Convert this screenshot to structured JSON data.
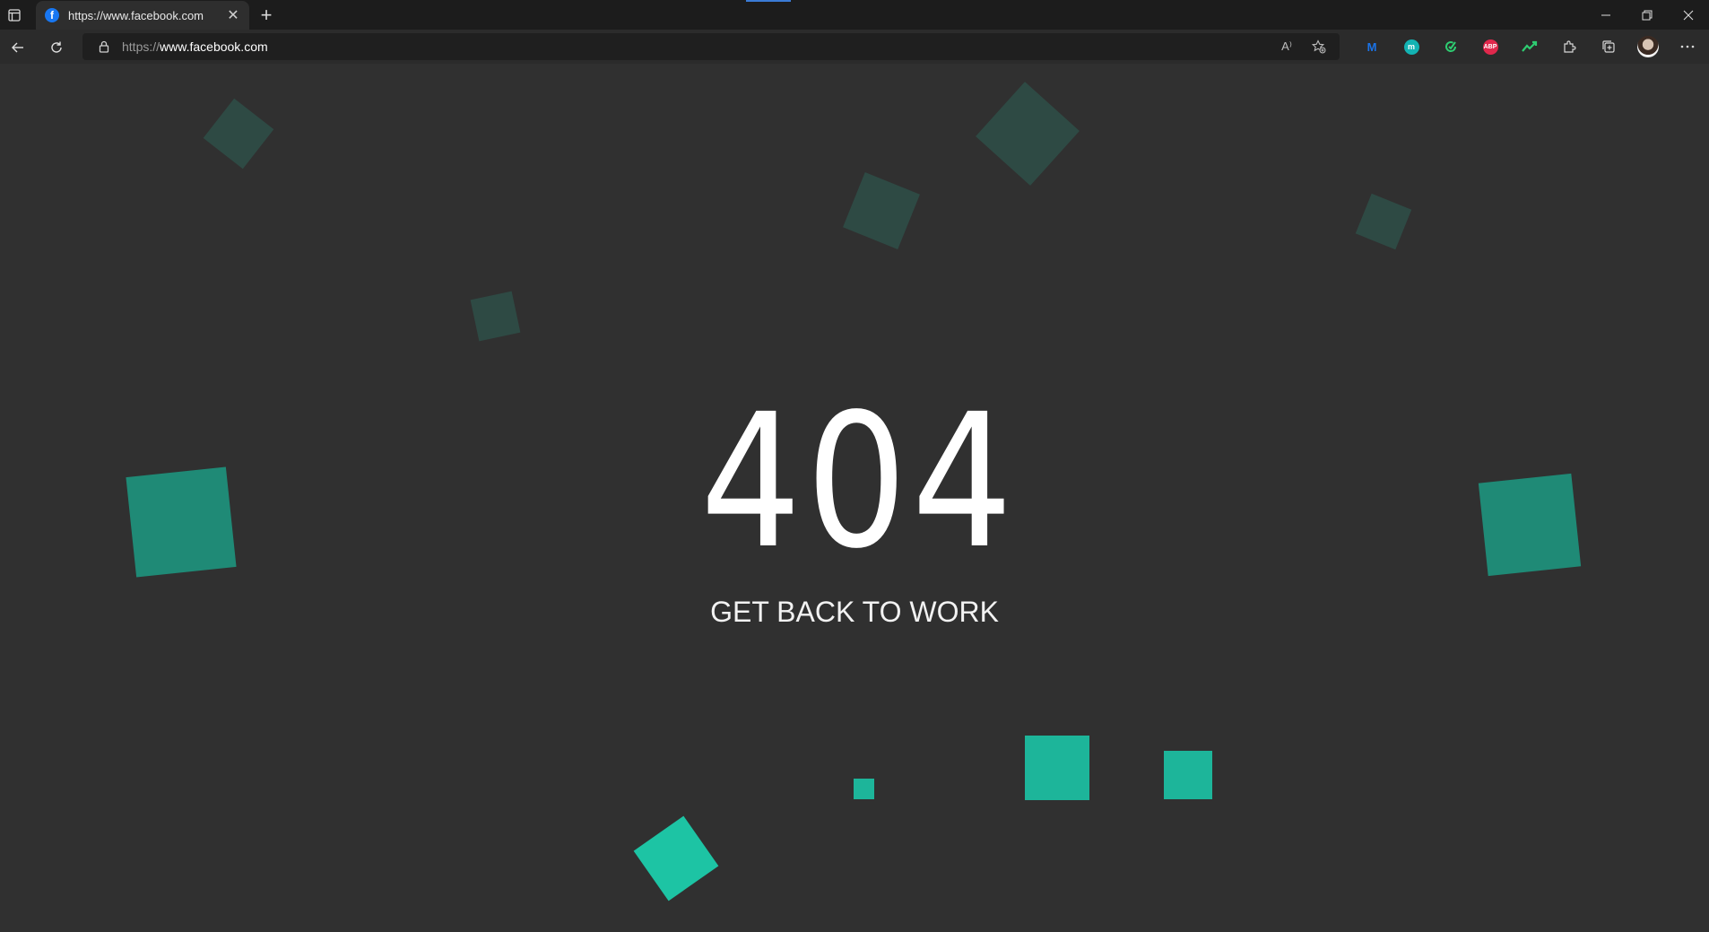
{
  "browser": {
    "tab_title": "https://www.facebook.com",
    "favicon_letter": "f",
    "url_scheme": "https://",
    "url_host": "www.facebook.com",
    "read_aloud_label": "A⁾",
    "new_tab_label": "+",
    "close_tab_label": "✕",
    "extensions": [
      {
        "name": "m-extension",
        "label": "M",
        "color": "#1a73e8"
      },
      {
        "name": "m-circle-extension",
        "label": "m",
        "color": "#13b3b3"
      },
      {
        "name": "refresh-check-extension",
        "label": "",
        "color": "#2ecc71"
      },
      {
        "name": "abp-extension",
        "label": "ABP",
        "color": "#e0284c"
      },
      {
        "name": "trend-extension",
        "label": "",
        "color": "#2ecc71"
      }
    ]
  },
  "page": {
    "code": "404",
    "message": "GET BACK TO WORK",
    "colors": {
      "background": "#303030",
      "square_dim": "#2e4a44",
      "square_mid": "#1f8a76",
      "square_bright": "#1db59a"
    }
  }
}
